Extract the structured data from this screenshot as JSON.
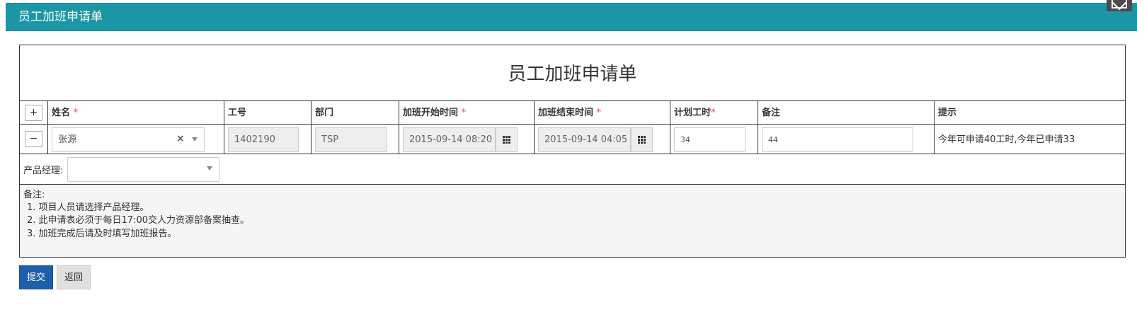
{
  "header": {
    "title": "员工加班申请单"
  },
  "form": {
    "title": "员工加班申请单",
    "columns": [
      {
        "label": "姓名",
        "required": "*"
      },
      {
        "label": "工号",
        "required": ""
      },
      {
        "label": "部门",
        "required": ""
      },
      {
        "label": "加班开始时间",
        "required": "*"
      },
      {
        "label": "加班结束时间",
        "required": "*"
      },
      {
        "label": "计划工时",
        "required": "*"
      },
      {
        "label": "备注",
        "required": ""
      },
      {
        "label": "提示",
        "required": ""
      }
    ],
    "add_button": "+",
    "remove_button": "−",
    "row": {
      "name": "张源",
      "employee_id": "1402190",
      "department": "TSP",
      "start_time": "2015-09-14 08:20",
      "end_time": "2015-09-14 04:05",
      "planned_hours": "34",
      "remark": "44",
      "hint": "今年可申请40工时,今年已申请33"
    },
    "manager": {
      "label": "产品经理:",
      "value": ""
    },
    "notes": {
      "title": "备注:",
      "items": [
        "1.  项目人员请选择产品经理。",
        "2.  此申请表必须于每日17:00交人力资源部备案抽查。",
        "3.  加班完成后请及时填写加班报告。"
      ]
    }
  },
  "buttons": {
    "submit": "提交",
    "back": "返回"
  },
  "icons": {
    "corner": "mail-icon",
    "calendar": "calendar-grid-icon",
    "clear": "clear-x-icon",
    "caret": "chevron-down-icon"
  },
  "colors": {
    "header_bg": "#1a96a6",
    "submit_bg": "#1d5fab",
    "required": "#d9534f"
  }
}
